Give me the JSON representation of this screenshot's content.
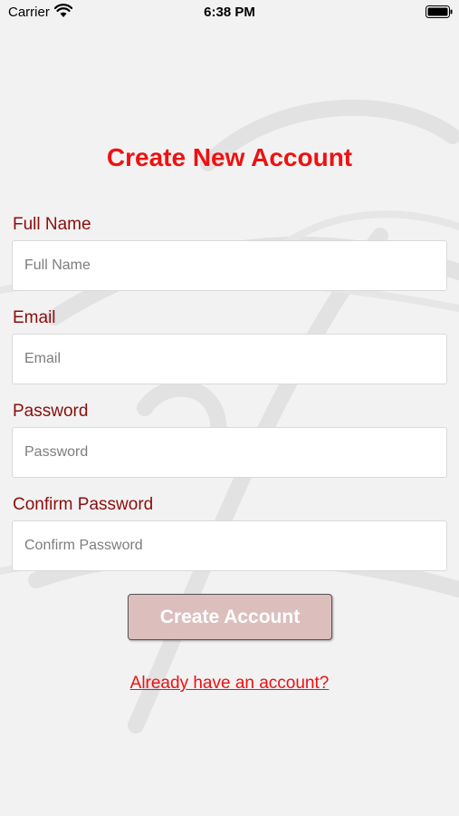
{
  "status_bar": {
    "carrier": "Carrier",
    "time": "6:38 PM"
  },
  "title": "Create New Account",
  "fields": {
    "full_name": {
      "label": "Full Name",
      "placeholder": "Full Name",
      "value": ""
    },
    "email": {
      "label": "Email",
      "placeholder": "Email",
      "value": ""
    },
    "password": {
      "label": "Password",
      "placeholder": "Password",
      "value": ""
    },
    "confirm_password": {
      "label": "Confirm Password",
      "placeholder": "Confirm Password",
      "value": ""
    }
  },
  "create_button_label": "Create Account",
  "login_link_label": "Already have an account?",
  "colors": {
    "accent_red": "#ee1111",
    "label_dark_red": "#8b0d0d",
    "button_disabled_bg": "#dcbfbd",
    "background": "#f2f2f2"
  },
  "icons": [
    "wifi-icon",
    "battery-icon"
  ]
}
